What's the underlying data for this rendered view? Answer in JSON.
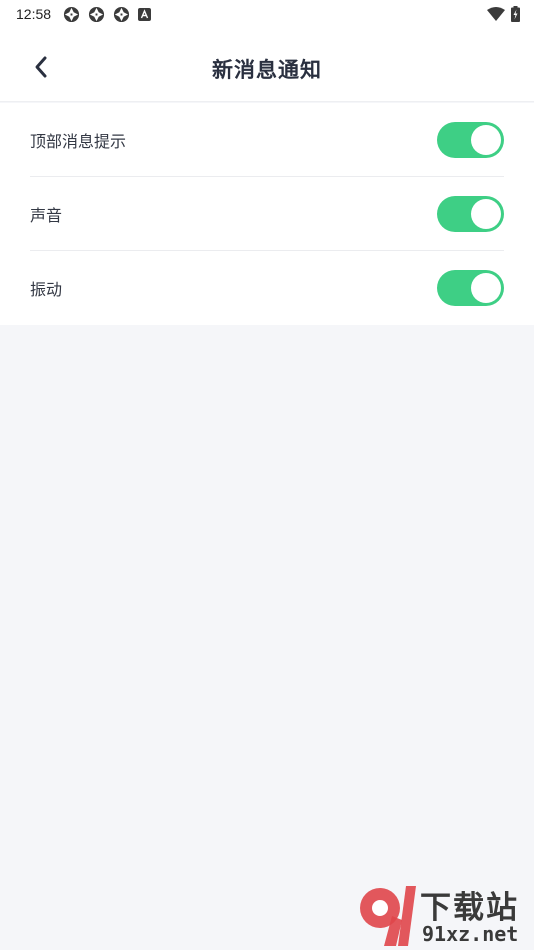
{
  "status_bar": {
    "time": "12:58",
    "notification_icons": [
      "aperture-icon",
      "aperture-icon",
      "aperture-icon",
      "a-box-icon"
    ],
    "right_icons": [
      "wifi-icon",
      "battery-charging-icon"
    ]
  },
  "header": {
    "title": "新消息通知",
    "back_icon": "chevron-left-icon"
  },
  "settings": [
    {
      "label": "顶部消息提示",
      "enabled": true
    },
    {
      "label": "声音",
      "enabled": true
    },
    {
      "label": "振动",
      "enabled": true
    }
  ],
  "watermark": {
    "top_text": "下载站",
    "bottom_text": "91xz.net"
  },
  "colors": {
    "toggle_on": "#3ecf85",
    "background": "#f5f6f9",
    "title": "#2a3040",
    "watermark_red": "#e0464a"
  }
}
